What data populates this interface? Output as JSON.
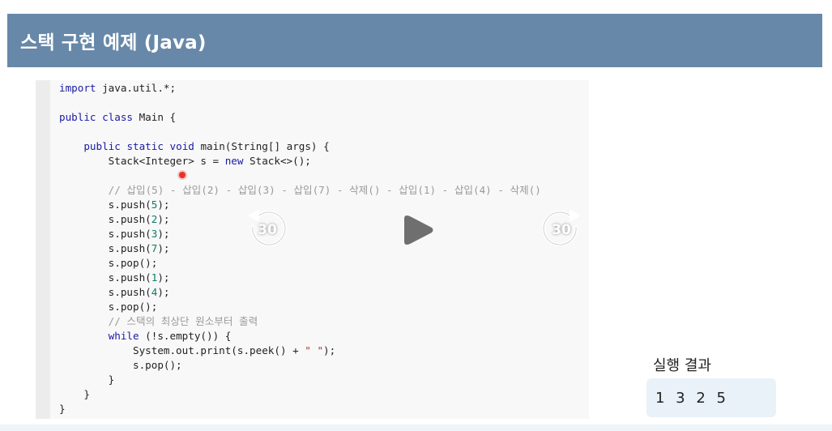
{
  "header": {
    "title": "스택 구현 예제 (Java)"
  },
  "code": {
    "language": "Java",
    "lines": [
      "import java.util.*;",
      "",
      "public class Main {",
      "",
      "    public static void main(String[] args) {",
      "        Stack<Integer> s = new Stack<>();",
      "",
      "        // 삽입(5) - 삽입(2) - 삽입(3) - 삽입(7) - 삭제() - 삽입(1) - 삽입(4) - 삭제()",
      "        s.push(5);",
      "        s.push(2);",
      "        s.push(3);",
      "        s.push(7);",
      "        s.pop();",
      "        s.push(1);",
      "        s.push(4);",
      "        s.pop();",
      "        // 스택의 최상단 원소부터 출력",
      "        while (!s.empty()) {",
      "            System.out.print(s.peek() + \" \");",
      "            s.pop();",
      "        }",
      "    }",
      "}"
    ]
  },
  "player": {
    "rewind_seconds": "30",
    "forward_seconds": "30",
    "play_icon": "play-icon",
    "rewind_icon": "rewind-30-icon",
    "forward_icon": "forward-30-icon"
  },
  "result": {
    "label": "실행 결과",
    "value": "1 3 2 5"
  },
  "colors": {
    "header_bg": "#6788a8",
    "keyword": "#1a1aa6",
    "number": "#0a7d6a",
    "comment": "#9a9a9a",
    "string": "#b5331f",
    "result_bg": "#e9f1f9"
  }
}
